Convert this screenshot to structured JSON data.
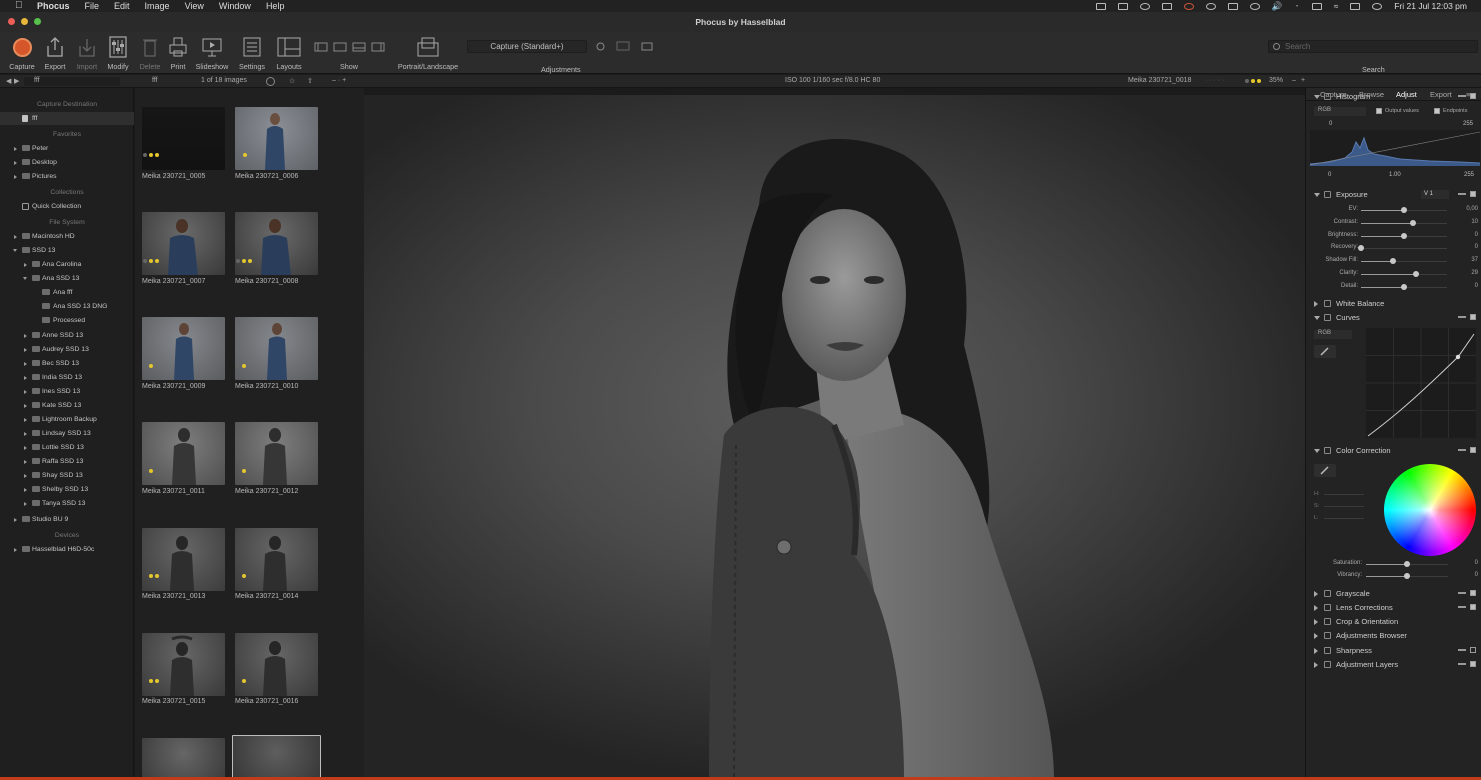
{
  "menubar": {
    "app": "Phocus",
    "items": [
      "File",
      "Edit",
      "Image",
      "View",
      "Window",
      "Help"
    ],
    "clock": "Fri 21 Jul  12:03 pm"
  },
  "window": {
    "title": "Phocus by Hasselblad"
  },
  "toolbar": {
    "capture": "Capture",
    "export": "Export",
    "import": "Import",
    "modify": "Modify",
    "delete": "Delete",
    "print": "Print",
    "slideshow": "Slideshow",
    "settings": "Settings",
    "layouts": "Layouts",
    "show": "Show",
    "portrait_landscape": "Portrait/Landscape",
    "style_value": "Capture (Standard+)",
    "adjustments": "Adjustments",
    "search_placeholder": "Search",
    "search_label": "Search"
  },
  "subbar": {
    "folder": "fff",
    "folder2": "fff",
    "count": "1 of 18 images",
    "exif": "ISO 100   1/160 sec   f/8.0   HC 80",
    "filename": "Meika 230721_0018",
    "zoom": "35%"
  },
  "library": {
    "capture_destination": "Capture Destination",
    "destination": "fff",
    "favorites": "Favorites",
    "fav_items": [
      "Peter",
      "Desktop",
      "Pictures"
    ],
    "collections": "Collections",
    "quick_collection": "Quick Collection",
    "file_system": "File System",
    "macintosh": "Macintosh HD",
    "ssd": "SSD 13",
    "ssd_items": [
      "Ana Carolina",
      "Ana SSD 13"
    ],
    "ana_sub": [
      "Ana fff",
      "Ana SSD 13 DNG",
      "Processed"
    ],
    "more_items": [
      "Anne SSD 13",
      "Audrey SSD 13",
      "Bec SSD 13",
      "India SSD 13",
      "Ines SSD 13",
      "Kate SSD 13",
      "Lightroom Backup",
      "Lindsay SSD 13",
      "Lottie SSD 13",
      "Raffa SSD 13",
      "Shay SSD 13",
      "Shelby SSD 13",
      "Tanya SSD 13"
    ],
    "studio": "Studio BU 9",
    "devices": "Devices",
    "device": "Hasselblad H6D-50c"
  },
  "thumbnails": [
    {
      "name": "Meika 230721_0005"
    },
    {
      "name": "Meika 230721_0006"
    },
    {
      "name": "Meika 230721_0007"
    },
    {
      "name": "Meika 230721_0008"
    },
    {
      "name": "Meika 230721_0009"
    },
    {
      "name": "Meika 230721_0010"
    },
    {
      "name": "Meika 230721_0011"
    },
    {
      "name": "Meika 230721_0012"
    },
    {
      "name": "Meika 230721_0013"
    },
    {
      "name": "Meika 230721_0014"
    },
    {
      "name": "Meika 230721_0015"
    },
    {
      "name": "Meika 230721_0016"
    }
  ],
  "right": {
    "tabs": [
      "Capture",
      "Browse",
      "Adjust",
      "Export"
    ],
    "active_tab": "Adjust",
    "histogram": "Histogram",
    "hist_channel": "RGB",
    "output_values": "Output values",
    "endpoints": "Endpoints",
    "hist_in_low": "0",
    "hist_in_high": "255",
    "hist_out_low": "0",
    "hist_gamma": "1.00",
    "hist_out_high": "255",
    "exposure": "Exposure",
    "exposure_version": "V 1",
    "sliders": [
      {
        "label": "EV:",
        "value": "0,00",
        "level": 0.5
      },
      {
        "label": "Contrast:",
        "value": "10",
        "level": 0.6
      },
      {
        "label": "Brightness:",
        "value": "0",
        "level": 0.5
      },
      {
        "label": "Recovery:",
        "value": "0",
        "level": 0.0
      },
      {
        "label": "Shadow Fill:",
        "value": "37",
        "level": 0.37
      },
      {
        "label": "Clarity:",
        "value": "29",
        "level": 0.64
      },
      {
        "label": "Detail:",
        "value": "0",
        "level": 0.5
      }
    ],
    "white_balance": "White Balance",
    "curves": "Curves",
    "curves_channel": "RGB",
    "color_correction": "Color Correction",
    "hsl": [
      "H:",
      "S:",
      "L:"
    ],
    "cc_sliders": [
      {
        "label": "Saturation:",
        "value": "0",
        "level": 0.5
      },
      {
        "label": "Vibrancy:",
        "value": "0",
        "level": 0.5
      }
    ],
    "collapsed": [
      "Grayscale",
      "Lens Corrections",
      "Crop & Orientation",
      "Adjustments Browser",
      "Sharpness",
      "Adjustment Layers"
    ]
  }
}
